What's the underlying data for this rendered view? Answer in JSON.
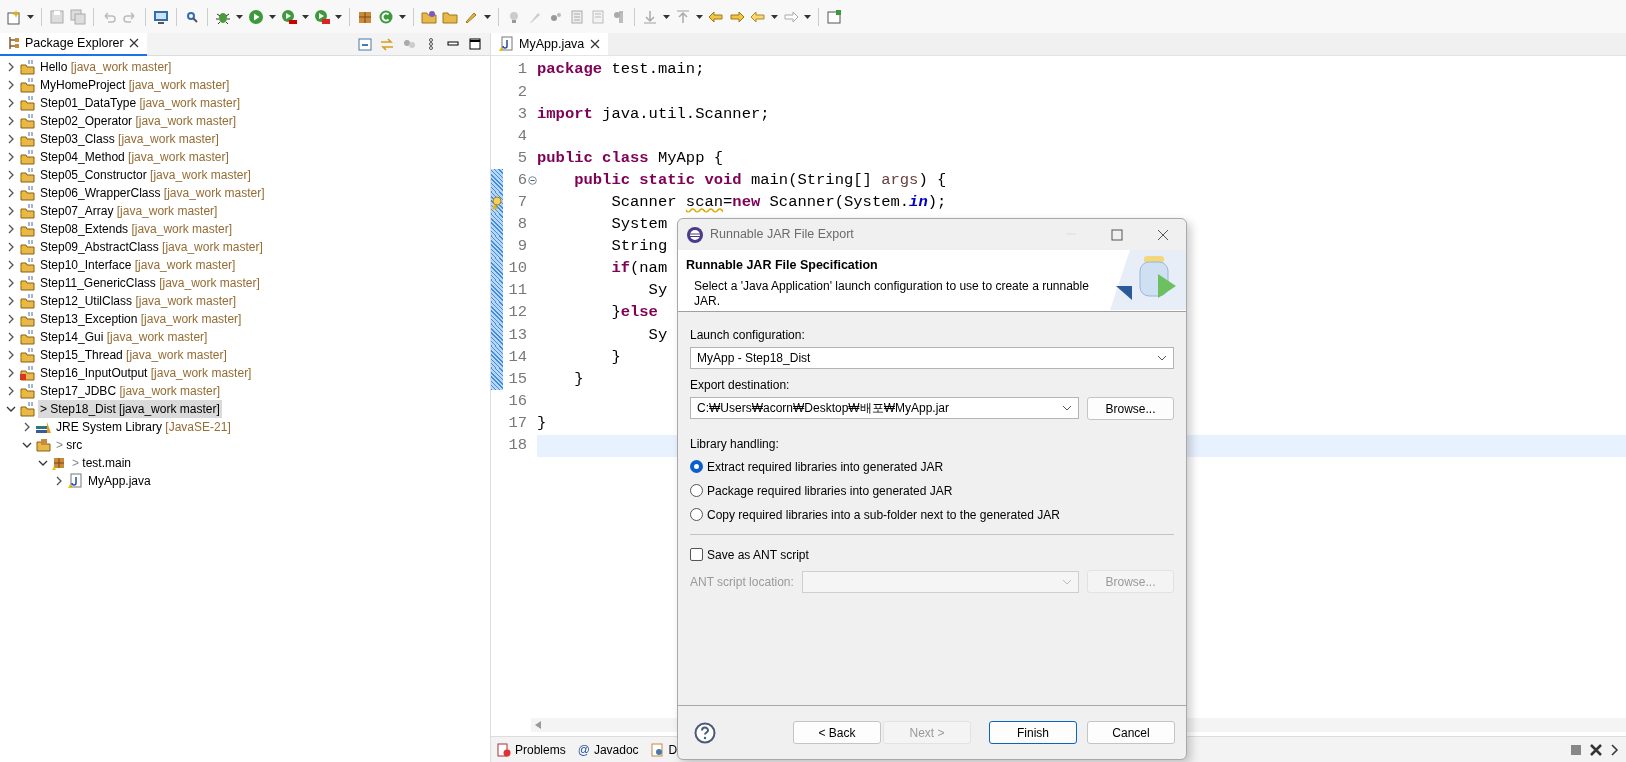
{
  "explorer": {
    "title": "Package Explorer",
    "tree": [
      {
        "kind": "project",
        "name": "Hello",
        "tag": "[java_work master]",
        "expanded": false,
        "selected": false
      },
      {
        "kind": "project",
        "name": "MyHomeProject",
        "tag": "[java_work master]",
        "expanded": false,
        "selected": false
      },
      {
        "kind": "project",
        "name": "Step01_DataType",
        "tag": "[java_work master]",
        "expanded": false,
        "selected": false
      },
      {
        "kind": "project",
        "name": "Step02_Operator",
        "tag": "[java_work master]",
        "expanded": false,
        "selected": false
      },
      {
        "kind": "project",
        "name": "Step03_Class",
        "tag": "[java_work master]",
        "expanded": false,
        "selected": false
      },
      {
        "kind": "project",
        "name": "Step04_Method",
        "tag": "[java_work master]",
        "expanded": false,
        "selected": false
      },
      {
        "kind": "project",
        "name": "Step05_Constructor",
        "tag": "[java_work master]",
        "expanded": false,
        "selected": false
      },
      {
        "kind": "project",
        "name": "Step06_WrapperClass",
        "tag": "[java_work master]",
        "expanded": false,
        "selected": false
      },
      {
        "kind": "project",
        "name": "Step07_Array",
        "tag": "[java_work master]",
        "expanded": false,
        "selected": false
      },
      {
        "kind": "project",
        "name": "Step08_Extends",
        "tag": "[java_work master]",
        "expanded": false,
        "selected": false
      },
      {
        "kind": "project",
        "name": "Step09_AbstractClass",
        "tag": "[java_work master]",
        "expanded": false,
        "selected": false
      },
      {
        "kind": "project",
        "name": "Step10_Interface",
        "tag": "[java_work master]",
        "expanded": false,
        "selected": false
      },
      {
        "kind": "project",
        "name": "Step11_GenericClass",
        "tag": "[java_work master]",
        "expanded": false,
        "selected": false
      },
      {
        "kind": "project",
        "name": "Step12_UtilClass",
        "tag": "[java_work master]",
        "expanded": false,
        "selected": false
      },
      {
        "kind": "project",
        "name": "Step13_Exception",
        "tag": "[java_work master]",
        "expanded": false,
        "selected": false
      },
      {
        "kind": "project",
        "name": "Step14_Gui",
        "tag": "[java_work master]",
        "expanded": false,
        "selected": false
      },
      {
        "kind": "project",
        "name": "Step15_Thread",
        "tag": "[java_work master]",
        "expanded": false,
        "selected": false
      },
      {
        "kind": "project-error",
        "name": "Step16_InputOutput",
        "tag": "[java_work master]",
        "expanded": false,
        "selected": false
      },
      {
        "kind": "project",
        "name": "Step17_JDBC",
        "tag": "[java_work master]",
        "expanded": false,
        "selected": false
      },
      {
        "kind": "project",
        "prefix": ">",
        "name": "Step18_Dist [java_work master]",
        "expanded": true,
        "selected": true,
        "children": [
          {
            "kind": "library",
            "name": "JRE System Library",
            "tag": "[JavaSE-21]",
            "expanded": false,
            "selected": false
          },
          {
            "kind": "source-folder",
            "prefix": ">",
            "name": "src",
            "expanded": true,
            "selected": false,
            "children": [
              {
                "kind": "package",
                "prefix": ">",
                "name": "test.main",
                "expanded": true,
                "selected": false,
                "children": [
                  {
                    "kind": "java-file",
                    "name": "MyApp.java",
                    "expanded": false,
                    "selected": false
                  }
                ]
              }
            ]
          }
        ]
      }
    ]
  },
  "editor": {
    "tab": "MyApp.java",
    "lines": [
      {
        "number": "1",
        "kind": "plain",
        "changed": false,
        "current": false,
        "segments": [
          {
            "kind": "keyword",
            "text": "package"
          },
          {
            "kind": "plain",
            "text": " test.main;"
          }
        ]
      },
      {
        "number": "2",
        "kind": "plain",
        "changed": false,
        "current": false
      },
      {
        "number": "3",
        "kind": "plain",
        "changed": false,
        "current": false,
        "segments": [
          {
            "kind": "keyword",
            "text": "import"
          },
          {
            "kind": "plain",
            "text": " java.util.Scanner;"
          }
        ]
      },
      {
        "number": "4",
        "kind": "plain",
        "changed": false,
        "current": false
      },
      {
        "number": "5",
        "kind": "plain",
        "changed": false,
        "current": false,
        "segments": [
          {
            "kind": "keyword",
            "text": "public class"
          },
          {
            "kind": "plain",
            "text": " MyApp {"
          }
        ]
      },
      {
        "number": "6",
        "kind": "fold",
        "changed": true,
        "current": false,
        "segments": [
          {
            "kind": "keyword",
            "text": "    public static void"
          },
          {
            "kind": "plain",
            "text": " main(String[] "
          },
          {
            "kind": "param",
            "text": "args"
          },
          {
            "kind": "plain",
            "text": ") {"
          }
        ]
      },
      {
        "number": "7",
        "kind": "warning",
        "changed": true,
        "current": false,
        "segments": [
          {
            "kind": "plain",
            "text": "        Scanner "
          },
          {
            "kind": "warning",
            "text": "scan"
          },
          {
            "kind": "plain",
            "text": "="
          },
          {
            "kind": "keyword",
            "text": "new"
          },
          {
            "kind": "plain",
            "text": " Scanner(System."
          },
          {
            "kind": "field",
            "text": "in"
          },
          {
            "kind": "plain",
            "text": ");"
          }
        ]
      },
      {
        "number": "8",
        "kind": "plain",
        "changed": true,
        "current": false,
        "segments": [
          {
            "kind": "plain",
            "text": "        System"
          }
        ]
      },
      {
        "number": "9",
        "kind": "plain",
        "changed": true,
        "current": false,
        "segments": [
          {
            "kind": "plain",
            "text": "        String"
          }
        ]
      },
      {
        "number": "10",
        "kind": "plain",
        "changed": true,
        "current": false,
        "segments": [
          {
            "kind": "keyword",
            "text": "        if"
          },
          {
            "kind": "plain",
            "text": "(nam"
          }
        ]
      },
      {
        "number": "11",
        "kind": "plain",
        "changed": true,
        "current": false,
        "segments": [
          {
            "kind": "plain",
            "text": "            Sy"
          }
        ]
      },
      {
        "number": "12",
        "kind": "plain",
        "changed": true,
        "current": false,
        "segments": [
          {
            "kind": "plain",
            "text": "        }"
          },
          {
            "kind": "keyword",
            "text": "else"
          }
        ]
      },
      {
        "number": "13",
        "kind": "plain",
        "changed": true,
        "current": false,
        "segments": [
          {
            "kind": "plain",
            "text": "            Sy"
          }
        ]
      },
      {
        "number": "14",
        "kind": "plain",
        "changed": true,
        "current": false,
        "segments": [
          {
            "kind": "plain",
            "text": "        }"
          }
        ]
      },
      {
        "number": "15",
        "kind": "plain",
        "changed": true,
        "current": false,
        "segments": [
          {
            "kind": "plain",
            "text": "    }"
          }
        ]
      },
      {
        "number": "16",
        "kind": "plain",
        "changed": false,
        "current": false
      },
      {
        "number": "17",
        "kind": "plain",
        "changed": false,
        "current": false,
        "segments": [
          {
            "kind": "plain",
            "text": "}"
          }
        ]
      },
      {
        "number": "18",
        "kind": "plain",
        "changed": false,
        "current": true
      }
    ]
  },
  "bottom_tabs": [
    {
      "kind": "problems",
      "label": "Problems"
    },
    {
      "kind": "javadoc",
      "glyph": "@",
      "label": "Javadoc"
    },
    {
      "kind": "declaration",
      "label": "D"
    }
  ],
  "dialog": {
    "title": "Runnable JAR File Export",
    "heading": "Runnable JAR File Specification",
    "description": "Select a 'Java Application' launch configuration to use to create a runnable JAR.",
    "launch_label": "Launch configuration:",
    "launch_value": "MyApp - Step18_Dist",
    "destination_label": "Export destination:",
    "destination_value": "C:₩Users₩acorn₩Desktop₩배포₩MyApp.jar",
    "browse": "Browse...",
    "library_label": "Library handling:",
    "library_options": [
      {
        "label": "Extract required libraries into generated JAR",
        "selected": true
      },
      {
        "label": "Package required libraries into generated JAR",
        "selected": false
      },
      {
        "label": "Copy required libraries into a sub-folder next to the generated JAR",
        "selected": false
      }
    ],
    "save_ant": {
      "label": "Save as ANT script",
      "checked": false
    },
    "ant_location_label": "ANT script location:",
    "ant_browse": "Browse...",
    "buttons": [
      {
        "label": "< Back",
        "disabled": false,
        "default": false
      },
      {
        "label": "Next >",
        "disabled": true,
        "default": false
      },
      {
        "label": "Finish",
        "disabled": false,
        "default": true
      },
      {
        "label": "Cancel",
        "disabled": false,
        "default": false
      }
    ]
  }
}
